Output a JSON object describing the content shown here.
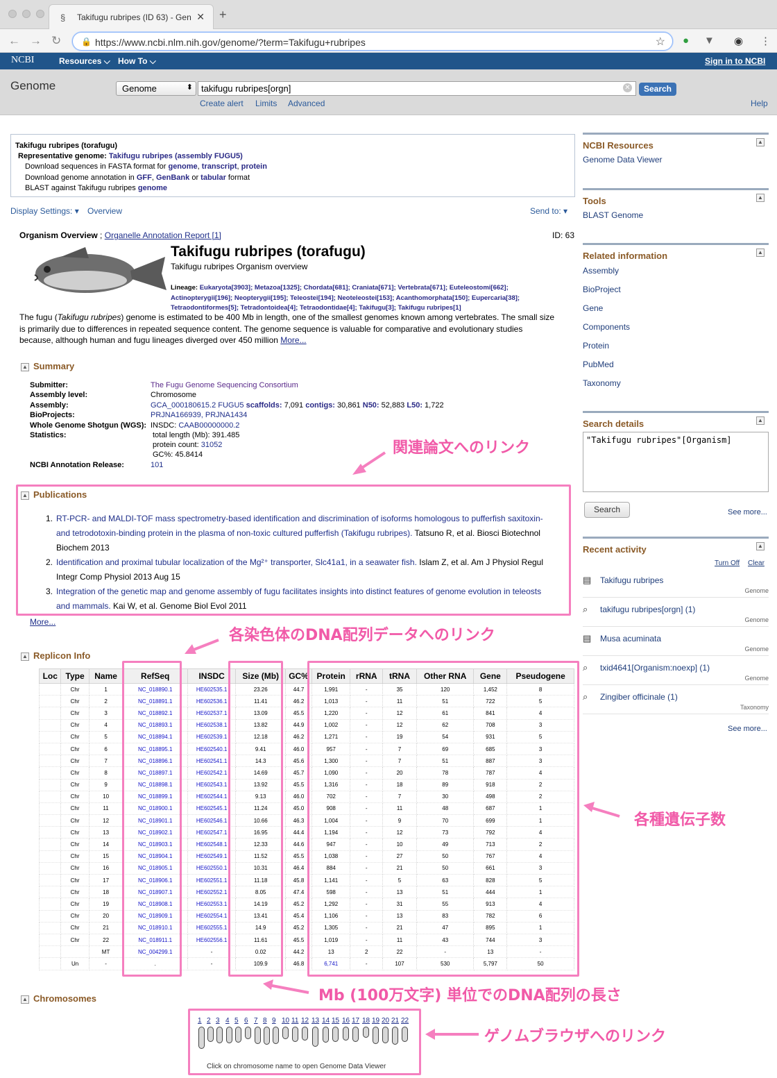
{
  "browser": {
    "tab_title": "Takifugu rubripes (ID 63) - Gen",
    "url": "https://www.ncbi.nlm.nih.gov/genome/?term=Takifugu+rubripes"
  },
  "ncbi": {
    "logo": "NCBI",
    "resources": "Resources",
    "howto": "How To",
    "signin": "Sign in to NCBI"
  },
  "search": {
    "db_title": "Genome",
    "db_select": "Genome",
    "term": "takifugu rubripes[orgn]",
    "button": "Search",
    "create_alert": "Create alert",
    "limits": "Limits",
    "advanced": "Advanced",
    "help": "Help"
  },
  "ribbon": {
    "title": "Takifugu rubripes (torafugu)",
    "rep_label": "Representative genome:",
    "rep_link": "Takifugu rubripes (assembly FUGU5)",
    "l3_pre": "Download sequences in FASTA format for ",
    "l3_a": "genome",
    "l3_b": "transcript",
    "l3_c": "protein",
    "l4_pre": "Download genome annotation in ",
    "l4_a": "GFF",
    "l4_b": "GenBank",
    "l4_or": " or ",
    "l4_c": "tabular",
    "l4_post": " format",
    "l5_pre": "BLAST against Takifugu rubripes ",
    "l5_a": "genome"
  },
  "display_settings": "Display Settings:",
  "overview_link": "Overview",
  "send_to": "Send to:",
  "overview": {
    "head_bold": "Organism Overview",
    "head_sep": " ; ",
    "head_link": "Organelle Annotation Report [1]",
    "id": "ID: 63",
    "title": "Takifugu rubripes (torafugu)",
    "subtitle": "Takifugu rubripes Organism overview",
    "lineage_label": "Lineage: ",
    "lineage_1": "Eukaryota[3903]; Metazoa[1325]; Chordata[681]; Craniata[671]; Vertebrata[671]; Euteleostomi[662];",
    "lineage_2": "Actinopterygii[196]; Neopterygii[195]; Teleostei[194]; Neoteleostei[153]; Acanthomorphata[150]; Eupercaria[38];",
    "lineage_3": "Tetraodontiformes[5]; Tetradontoidea[4]; Tetraodontidae[4]; Takifugu[3]; Takifugu rubripes[1]",
    "desc_1a": "The fugu (",
    "desc_1b": "Takifugu rubripes",
    "desc_1c": ") genome is estimated to be 400 Mb in length, one of the smallest genomes known among vertebrates. The small size",
    "desc_2": "is primarily due to differences in repeated sequence content. The genome sequence is valuable for comparative and evolutionary studies",
    "desc_3": "because, although human and fugu lineages diverged over 450 million ",
    "desc_more": "More..."
  },
  "summary": {
    "heading": "Summary",
    "submitter_l": "Submitter:",
    "submitter_v": "The Fugu Genome Sequencing Consortium",
    "level_l": "Assembly level:",
    "level_v": "Chromosome",
    "assembly_l": "Assembly:",
    "assembly_acc": "GCA_000180615.2 FUGU5",
    "sc_l": " scaffolds: ",
    "sc_v": "7,091",
    "co_l": " contigs: ",
    "co_v": "30,861",
    "n50_l": " N50: ",
    "n50_v": "52,883",
    "l50_l": " L50: ",
    "l50_v": "1,722",
    "bp_l": "BioProjects:",
    "bp_v": "PRJNA166939, PRJNA1434",
    "wgs_l": "Whole Genome Shotgun (WGS):",
    "wgs_pre": "INSDC: ",
    "wgs_v": "CAAB00000000.2",
    "stats_l": "Statistics:",
    "stats_1": "total length (Mb): 391.485",
    "stats_2_pre": "protein count: ",
    "stats_2_v": "31052",
    "stats_3": "GC%: 45.8414",
    "rel_l": "NCBI Annotation Release:",
    "rel_v": "101"
  },
  "publications": {
    "heading": "Publications",
    "items": [
      {
        "n": "1.",
        "link1": "RT-PCR- and MALDI-TOF mass spectrometry-based identification and discrimination of isoforms homologous to pufferfish saxitoxin-",
        "link2": "and tetrodotoxin-binding protein in the plasma of non-toxic cultured pufferfish (Takifugu rubripes).",
        "rest1": " Tatsuno R, et al. Biosci Biotechnol",
        "rest2": "Biochem 2013"
      },
      {
        "n": "2.",
        "link1": "Identification and proximal tubular localization of the Mg²⁺ transporter, Slc41a1, in a seawater fish.",
        "rest1": " Islam Z, et al. Am J Physiol Regul",
        "rest2": "Integr Comp Physiol 2013 Aug 15"
      },
      {
        "n": "3.",
        "link1": "Integration of the genetic map and genome assembly of fugu facilitates insights into distinct features of genome evolution in teleosts",
        "link2": "and mammals.",
        "rest1": " Kai W, et al. Genome Biol Evol 2011"
      }
    ],
    "more": "More..."
  },
  "replicon": {
    "heading": "Replicon Info",
    "headers": [
      "Loc",
      "Type",
      "Name",
      "RefSeq",
      "INSDC",
      "Size (Mb)",
      "GC%",
      "Protein",
      "rRNA",
      "tRNA",
      "Other RNA",
      "Gene",
      "Pseudogene"
    ],
    "rows": [
      [
        "",
        "Chr",
        "1",
        "NC_018890.1",
        "HE602535.1",
        "23.26",
        "44.7",
        "1,991",
        "-",
        "35",
        "120",
        "1,452",
        "8"
      ],
      [
        "",
        "Chr",
        "2",
        "NC_018891.1",
        "HE602536.1",
        "11.41",
        "46.2",
        "1,013",
        "-",
        "11",
        "51",
        "722",
        "5"
      ],
      [
        "",
        "Chr",
        "3",
        "NC_018892.1",
        "HE602537.1",
        "13.09",
        "45.5",
        "1,220",
        "-",
        "12",
        "61",
        "841",
        "4"
      ],
      [
        "",
        "Chr",
        "4",
        "NC_018893.1",
        "HE602538.1",
        "13.82",
        "44.9",
        "1,002",
        "-",
        "12",
        "62",
        "708",
        "3"
      ],
      [
        "",
        "Chr",
        "5",
        "NC_018894.1",
        "HE602539.1",
        "12.18",
        "46.2",
        "1,271",
        "-",
        "19",
        "54",
        "931",
        "5"
      ],
      [
        "",
        "Chr",
        "6",
        "NC_018895.1",
        "HE602540.1",
        "9.41",
        "46.0",
        "957",
        "-",
        "7",
        "69",
        "685",
        "3"
      ],
      [
        "",
        "Chr",
        "7",
        "NC_018896.1",
        "HE602541.1",
        "14.3",
        "45.6",
        "1,300",
        "-",
        "7",
        "51",
        "887",
        "3"
      ],
      [
        "",
        "Chr",
        "8",
        "NC_018897.1",
        "HE602542.1",
        "14.69",
        "45.7",
        "1,090",
        "-",
        "20",
        "78",
        "787",
        "4"
      ],
      [
        "",
        "Chr",
        "9",
        "NC_018898.1",
        "HE602543.1",
        "13.92",
        "45.5",
        "1,316",
        "-",
        "18",
        "89",
        "918",
        "2"
      ],
      [
        "",
        "Chr",
        "10",
        "NC_018899.1",
        "HE602544.1",
        "9.13",
        "46.0",
        "702",
        "-",
        "7",
        "30",
        "498",
        "2"
      ],
      [
        "",
        "Chr",
        "11",
        "NC_018900.1",
        "HE602545.1",
        "11.24",
        "45.0",
        "908",
        "-",
        "11",
        "48",
        "687",
        "1"
      ],
      [
        "",
        "Chr",
        "12",
        "NC_018901.1",
        "HE602546.1",
        "10.66",
        "46.3",
        "1,004",
        "-",
        "9",
        "70",
        "699",
        "1"
      ],
      [
        "",
        "Chr",
        "13",
        "NC_018902.1",
        "HE602547.1",
        "16.95",
        "44.4",
        "1,194",
        "-",
        "12",
        "73",
        "792",
        "4"
      ],
      [
        "",
        "Chr",
        "14",
        "NC_018903.1",
        "HE602548.1",
        "12.33",
        "44.6",
        "947",
        "-",
        "10",
        "49",
        "713",
        "2"
      ],
      [
        "",
        "Chr",
        "15",
        "NC_018904.1",
        "HE602549.1",
        "11.52",
        "45.5",
        "1,038",
        "-",
        "27",
        "50",
        "767",
        "4"
      ],
      [
        "",
        "Chr",
        "16",
        "NC_018905.1",
        "HE602550.1",
        "10.31",
        "46.4",
        "884",
        "-",
        "21",
        "50",
        "661",
        "3"
      ],
      [
        "",
        "Chr",
        "17",
        "NC_018906.1",
        "HE602551.1",
        "11.18",
        "45.8",
        "1,141",
        "-",
        "5",
        "63",
        "828",
        "5"
      ],
      [
        "",
        "Chr",
        "18",
        "NC_018907.1",
        "HE602552.1",
        "8.05",
        "47.4",
        "598",
        "-",
        "13",
        "51",
        "444",
        "1"
      ],
      [
        "",
        "Chr",
        "19",
        "NC_018908.1",
        "HE602553.1",
        "14.19",
        "45.2",
        "1,292",
        "-",
        "31",
        "55",
        "913",
        "4"
      ],
      [
        "",
        "Chr",
        "20",
        "NC_018909.1",
        "HE602554.1",
        "13.41",
        "45.4",
        "1,106",
        "-",
        "13",
        "83",
        "782",
        "6"
      ],
      [
        "",
        "Chr",
        "21",
        "NC_018910.1",
        "HE602555.1",
        "14.9",
        "45.2",
        "1,305",
        "-",
        "21",
        "47",
        "895",
        "1"
      ],
      [
        "",
        "Chr",
        "22",
        "NC_018911.1",
        "HE602556.1",
        "11.61",
        "45.5",
        "1,019",
        "-",
        "11",
        "43",
        "744",
        "3"
      ],
      [
        "",
        "",
        "MT",
        "NC_004299.1",
        "-",
        "0.02",
        "44.2",
        "13",
        "2",
        "22",
        "-",
        "13",
        "-"
      ],
      [
        "",
        "Un",
        "-",
        ".",
        "-",
        "109.9",
        "46.8",
        "6,741",
        "-",
        "107",
        "530",
        "5,797",
        "50"
      ]
    ]
  },
  "chromosomes": {
    "heading": "Chromosomes",
    "names": [
      "1",
      "2",
      "3",
      "4",
      "5",
      "6",
      "7",
      "8",
      "9",
      "10",
      "11",
      "12",
      "13",
      "14",
      "15",
      "16",
      "17",
      "18",
      "19",
      "20",
      "21",
      "22"
    ],
    "caption": "Click on chromosome name to open Genome Data Viewer"
  },
  "sidebar": {
    "resources_h": "NCBI Resources",
    "resources": [
      "Genome Data Viewer"
    ],
    "tools_h": "Tools",
    "tools": [
      "BLAST Genome"
    ],
    "related_h": "Related information",
    "related": [
      "Assembly",
      "BioProject",
      "Gene",
      "Components",
      "Protein",
      "PubMed",
      "Taxonomy"
    ],
    "search_h": "Search details",
    "search_query": "\"Takifugu rubripes\"[Organism]",
    "search_btn": "Search",
    "see_more": "See more...",
    "recent_h": "Recent activity",
    "turn_off": "Turn Off",
    "clear": "Clear",
    "recent": [
      {
        "text": "Takifugu rubripes",
        "db": "Genome",
        "icon": "document-icon"
      },
      {
        "text": "takifugu rubripes[orgn] (1)",
        "db": "Genome",
        "icon": "search-icon"
      },
      {
        "text": "Musa acuminata",
        "db": "Genome",
        "icon": "document-icon"
      },
      {
        "text": "txid4641[Organism:noexp] (1)",
        "db": "Genome",
        "icon": "search-icon"
      },
      {
        "text": "Zingiber officinale (1)",
        "db": "Taxonomy",
        "icon": "search-icon"
      }
    ],
    "recent_more": "See more..."
  },
  "annotations": {
    "pub": "関連論文へのリンク",
    "refseq": "各染色体のDNA配列データへのリンク",
    "genes": "各種遺伝子数",
    "size": "Mb (100万文字) 単位でのDNA配列の長さ",
    "browser": "ゲノムブラウザへのリンク",
    "color": "#f15aa8"
  }
}
